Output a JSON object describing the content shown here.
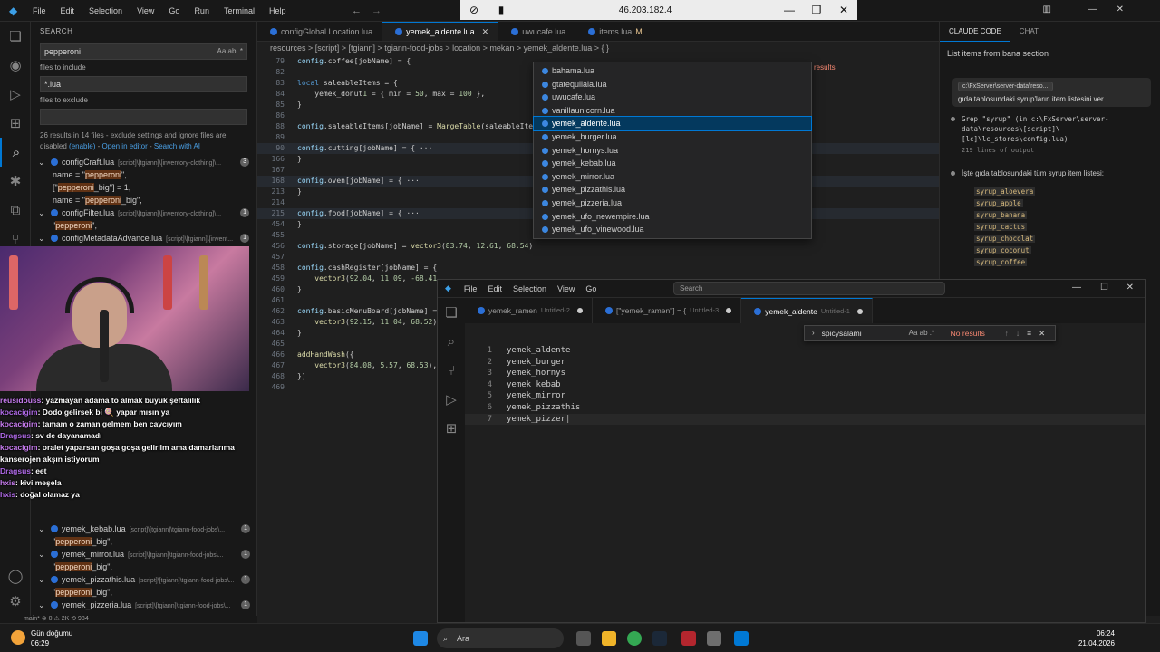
{
  "titlebar": {
    "menus": [
      "File",
      "Edit",
      "Selection",
      "View",
      "Go",
      "Run",
      "Terminal",
      "Help"
    ]
  },
  "remote": {
    "address": "46.203.182.4"
  },
  "sidebar": {
    "title": "SEARCH",
    "search_value": "pepperoni",
    "include_label": "files to include",
    "include_value": "*.lua",
    "exclude_label": "files to exclude",
    "message": "26 results in 14 files - exclude settings and ignore files are disabled",
    "enable_link": "(enable)",
    "open_editor_link": "Open in editor",
    "search_ai_link": "Search with AI",
    "results": [
      {
        "file": "configCraft.lua",
        "path": "[script]\\[tgiann]\\[inventory-clothing]\\...",
        "count": "3",
        "lines": [
          {
            "pre": "name = \"",
            "hl": "pepperoni",
            "post": "\","
          },
          {
            "pre": "[\"",
            "hl": "pepperoni",
            "post": "_big\"] = 1,"
          },
          {
            "pre": "name = \"",
            "hl": "pepperoni",
            "post": "_big\","
          }
        ]
      },
      {
        "file": "configFilter.lua",
        "path": "[script]\\[tgiann]\\[inventory-clothing]\\...",
        "count": "1",
        "lines": [
          {
            "pre": "\"",
            "hl": "pepperoni",
            "post": "\","
          }
        ]
      },
      {
        "file": "configMetadataAdvance.lua",
        "path": "[script]\\[tgiann]\\[invent...",
        "count": "1",
        "lines": []
      }
    ],
    "lower_results": [
      {
        "file": "yemek_kebab.lua",
        "path": "[script]\\[tgiann]\\tgiann-food-jobs\\...",
        "count": "1",
        "line_pre": "\"",
        "line_hl": "pepperoni",
        "line_post": "_big\","
      },
      {
        "file": "yemek_mirror.lua",
        "path": "[script]\\[tgiann]\\tgiann-food-jobs\\...",
        "count": "1",
        "line_pre": "\"",
        "line_hl": "pepperoni",
        "line_post": "_big\","
      },
      {
        "file": "yemek_pizzathis.lua",
        "path": "[script]\\[tgiann]\\tgiann-food-jobs\\...",
        "count": "1",
        "line_pre": "\"",
        "line_hl": "pepperoni",
        "line_post": "_big\","
      },
      {
        "file": "yemek_pizzeria.lua",
        "path": "[script]\\[tgiann]\\tgiann-food-jobs\\...",
        "count": "1",
        "line_pre": "",
        "line_hl": "",
        "line_post": ""
      }
    ]
  },
  "editor": {
    "tabs": [
      {
        "label": "configGlobal.Location.lua",
        "active": false,
        "mod": ""
      },
      {
        "label": "yemek_aldente.lua",
        "active": true,
        "mod": ""
      },
      {
        "label": "uwucafe.lua",
        "active": false,
        "mod": ""
      },
      {
        "label": "items.lua",
        "active": false,
        "mod": "M"
      }
    ],
    "breadcrumb": "resources > [script] > [tgiann] > tgiann-food-jobs > location > mekan > yemek_aldente.lua > { }",
    "lines": [
      {
        "n": "79",
        "t": "config.coffee[jobName] = {"
      },
      {
        "n": "82",
        "t": ""
      },
      {
        "n": "83",
        "t": "local saleableItems = {"
      },
      {
        "n": "84",
        "t": "    yemek_donut1 = { min = 50, max = 100 },"
      },
      {
        "n": "85",
        "t": "}"
      },
      {
        "n": "86",
        "t": ""
      },
      {
        "n": "88",
        "t": "config.saleableItems[jobName] = MargeTable(saleableItems"
      },
      {
        "n": "89",
        "t": ""
      },
      {
        "n": "90",
        "t": "config.cutting[jobName] = { ···"
      },
      {
        "n": "166",
        "t": "}"
      },
      {
        "n": "167",
        "t": ""
      },
      {
        "n": "168",
        "t": "config.oven[jobName] = { ···"
      },
      {
        "n": "213",
        "t": "}"
      },
      {
        "n": "214",
        "t": ""
      },
      {
        "n": "215",
        "t": "config.food[jobName] = { ···"
      },
      {
        "n": "454",
        "t": "}"
      },
      {
        "n": "455",
        "t": ""
      },
      {
        "n": "456",
        "t": "config.storage[jobName] = vector3(83.74, 12.61, 68.54)"
      },
      {
        "n": "457",
        "t": ""
      },
      {
        "n": "458",
        "t": "config.cashRegister[jobName] = {"
      },
      {
        "n": "459",
        "t": "    vector3(92.04, 11.09, -68.41"
      },
      {
        "n": "460",
        "t": "}"
      },
      {
        "n": "461",
        "t": ""
      },
      {
        "n": "462",
        "t": "config.basicMenuBoard[jobName] ="
      },
      {
        "n": "463",
        "t": "    vector3(92.15, 11.04, 68.52)"
      },
      {
        "n": "464",
        "t": "}"
      },
      {
        "n": "465",
        "t": ""
      },
      {
        "n": "466",
        "t": "addHandWash({"
      },
      {
        "n": "467",
        "t": "    vector3(84.08, 5.57, 68.53),"
      },
      {
        "n": "468",
        "t": "})"
      },
      {
        "n": "469",
        "t": ""
      }
    ],
    "results_hint": "results"
  },
  "quickpick": {
    "items": [
      "bahama.lua",
      "gtatequilala.lua",
      "uwucafe.lua",
      "vanillaunicorn.lua",
      "yemek_aldente.lua",
      "yemek_burger.lua",
      "yemek_hornys.lua",
      "yemek_kebab.lua",
      "yemek_mirror.lua",
      "yemek_pizzathis.lua",
      "yemek_pizzeria.lua",
      "yemek_ufo_newempire.lua",
      "yemek_ufo_vinewood.lua"
    ],
    "selected_index": 4
  },
  "rightpanel": {
    "tabs": [
      "CLAUDE CODE",
      "CHAT"
    ],
    "title": "List items from bana section",
    "user_chip": "c:\\FxServer\\server-data\\reso...",
    "user_msg": "gıda tablosundaki syrup'ların item listesini ver",
    "step_grep": "Grep \"syrup\" (in c:\\FxServer\\server-data\\resources\\[script]\\[lc]\\lc_stores\\config.lua)",
    "step_grep_sub": "219 lines of output",
    "step_text": "İşte gıda tablosundaki tüm syrup item listesi:",
    "syrups": [
      "syrup_aloevera",
      "syrup_apple",
      "syrup_banana",
      "syrup_cactus",
      "syrup_chocolat",
      "syrup_coconut",
      "syrup_coffee"
    ]
  },
  "chat": [
    {
      "user": "reusidouss",
      "msg": ": yazmayan adama to almak büyük şeftalilik"
    },
    {
      "user": "kocacigim",
      "msg": ": Dodo gelirsek bi 🍭 yapar mısın ya"
    },
    {
      "user": "kocacigim",
      "msg": ": tamam o zaman gelmem ben caycıyım"
    },
    {
      "user": "Dragsus",
      "msg": ": sv de dayanamadı"
    },
    {
      "user": "kocacigim",
      "msg": ": oralet yaparsan goşa goşa gelirilm ama damarlarıma kanserojen akşın istiyorum"
    },
    {
      "user": "Dragsus",
      "msg": ": eet"
    },
    {
      "user": "hxis",
      "msg": ": kivi meşela"
    },
    {
      "user": "hxis",
      "msg": ": doğal olamaz ya"
    }
  ],
  "win2": {
    "menus": [
      "File",
      "Edit",
      "Selection",
      "View",
      "Go"
    ],
    "search_placeholder": "Search",
    "tabs": [
      {
        "label": "yemek_ramen",
        "sub": "Untitled-2",
        "active": false
      },
      {
        "label": "[\"yemek_ramen\"] = {",
        "sub": "Untitled-3",
        "active": false
      },
      {
        "label": "yemek_aldente",
        "sub": "Untitled-1",
        "active": true
      }
    ],
    "find_value": "spicysalami",
    "find_result": "No results",
    "lines": [
      {
        "n": "1",
        "t": "yemek_aldente"
      },
      {
        "n": "2",
        "t": "yemek_burger"
      },
      {
        "n": "3",
        "t": "yemek_hornys"
      },
      {
        "n": "4",
        "t": "yemek_kebab"
      },
      {
        "n": "5",
        "t": "yemek_mirror"
      },
      {
        "n": "6",
        "t": "yemek_pizzathis"
      },
      {
        "n": "7",
        "t": "yemek_pizzer"
      }
    ]
  },
  "taskbar": {
    "weather_title": "Gün doğumu",
    "weather_time": "06:29",
    "search_label": "Ara",
    "clock_time": "06:24",
    "clock_date": "21.04.2026"
  },
  "statusbar": {
    "text": "main*  ⊗ 0 ⚠ 2K  ⟲ 984"
  },
  "colors": {
    "accent": "#0078d4",
    "match_highlight": "#613214",
    "lua_icon": "#2b6fd6"
  }
}
